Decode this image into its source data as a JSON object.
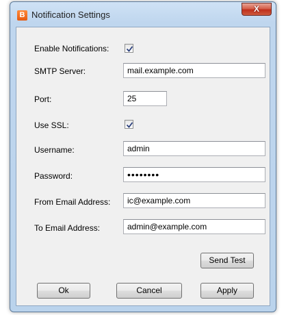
{
  "window": {
    "title": "Notification Settings",
    "app_icon_letter": "B",
    "close_label": "X"
  },
  "form": {
    "enable_notifications": {
      "label": "Enable Notifications:",
      "checked": true
    },
    "smtp_server": {
      "label": "SMTP Server:",
      "value": "mail.example.com"
    },
    "port": {
      "label": "Port:",
      "value": "25"
    },
    "use_ssl": {
      "label": "Use SSL:",
      "checked": true
    },
    "username": {
      "label": "Username:",
      "value": "admin"
    },
    "password": {
      "label": "Password:",
      "value": "••••••••"
    },
    "from_email": {
      "label": "From Email Address:",
      "value": "ic@example.com"
    },
    "to_email": {
      "label": "To Email Address:",
      "value": "admin@example.com"
    }
  },
  "buttons": {
    "send_test": "Send Test",
    "ok": "Ok",
    "cancel": "Cancel",
    "apply": "Apply"
  },
  "colors": {
    "title_bar": "#bfd6ee",
    "client_bg": "#f0f0f0",
    "close_button": "#c7402a",
    "app_icon": "#f07020"
  }
}
